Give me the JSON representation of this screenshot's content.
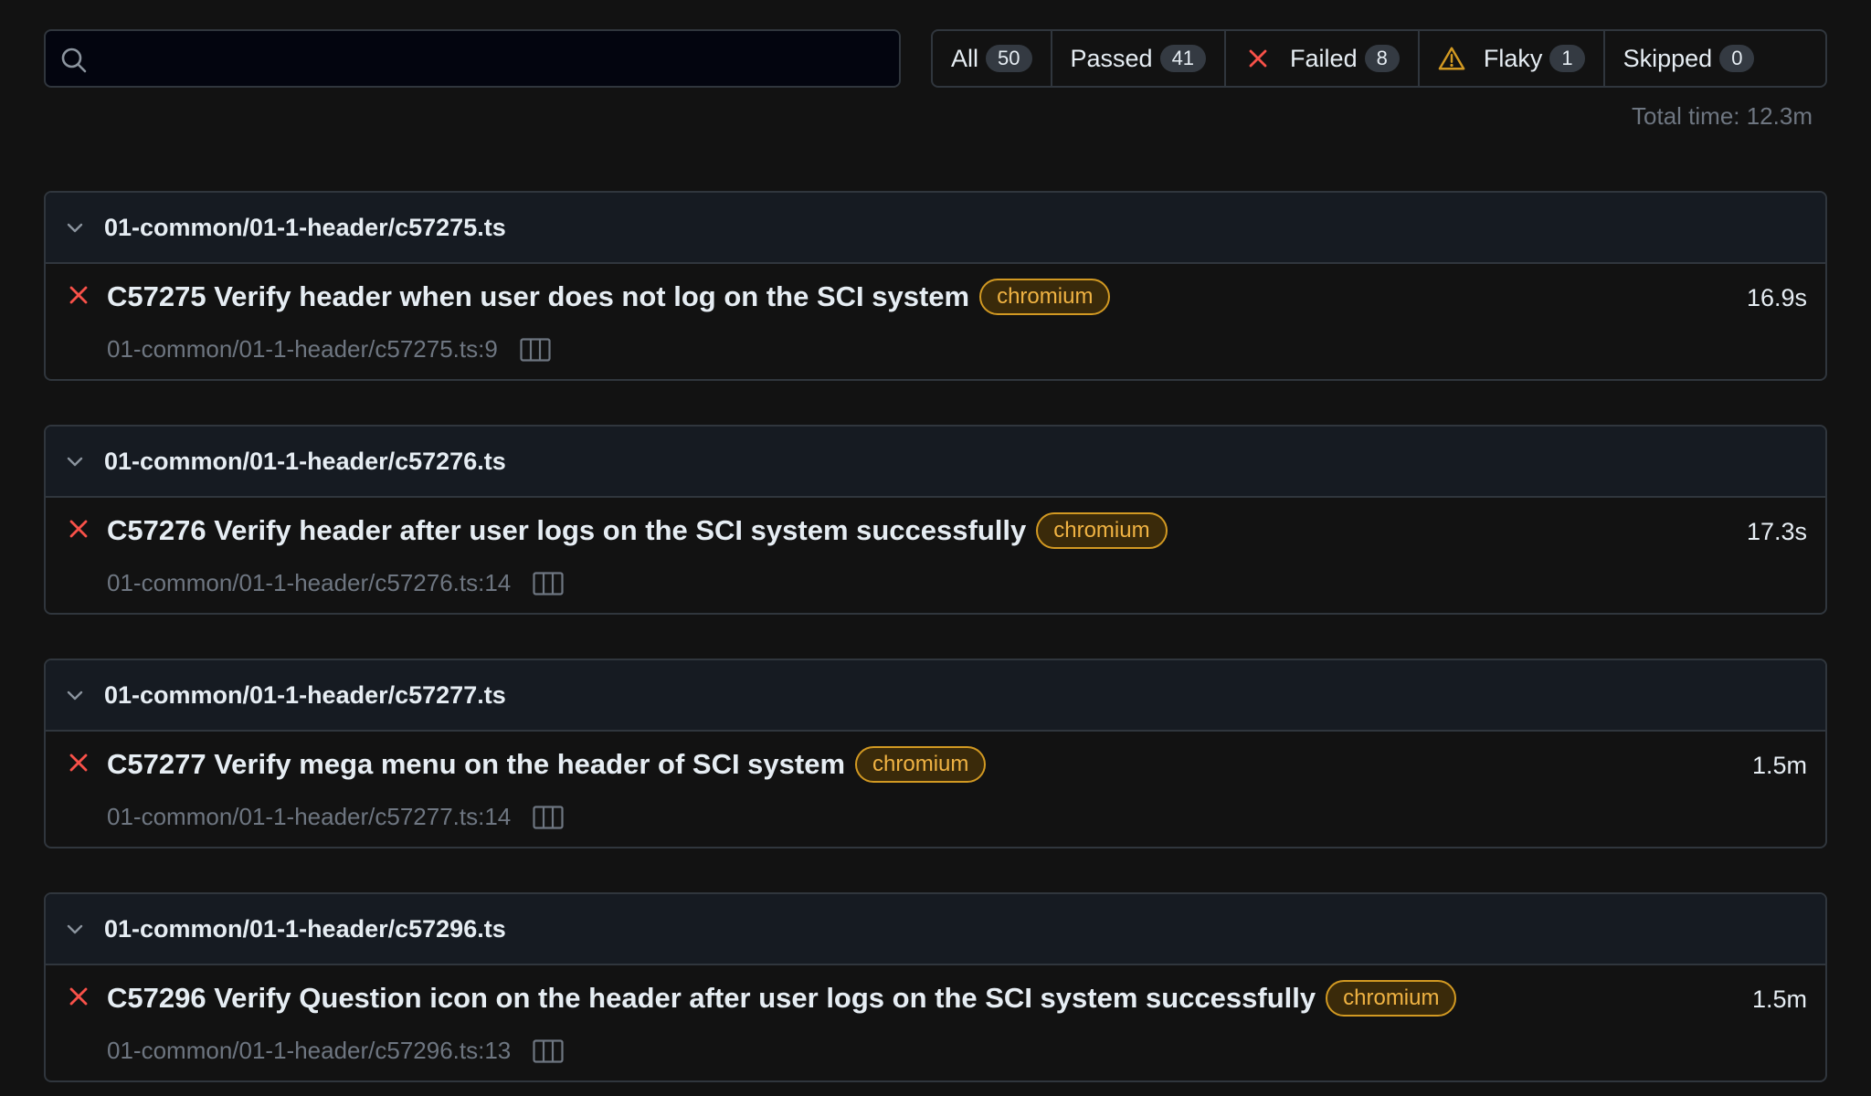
{
  "search": {
    "value": "",
    "placeholder": ""
  },
  "filters": [
    {
      "label": "All",
      "count": "50",
      "icon": ""
    },
    {
      "label": "Passed",
      "count": "41",
      "icon": ""
    },
    {
      "label": "Failed",
      "count": "8",
      "icon": "cross-icon"
    },
    {
      "label": "Flaky",
      "count": "1",
      "icon": "warning-icon"
    },
    {
      "label": "Skipped",
      "count": "0",
      "icon": ""
    }
  ],
  "total_time": "Total time: 12.3m",
  "groups": [
    {
      "file": "01-common/01-1-header/c57275.ts",
      "test": {
        "status": "failed",
        "title": "C57275 Verify header when user does not log on the SCI system",
        "tag": "chromium",
        "duration": "16.9s",
        "location": "01-common/01-1-header/c57275.ts:9"
      }
    },
    {
      "file": "01-common/01-1-header/c57276.ts",
      "test": {
        "status": "failed",
        "title": "C57276 Verify header after user logs on the SCI system successfully",
        "tag": "chromium",
        "duration": "17.3s",
        "location": "01-common/01-1-header/c57276.ts:14"
      }
    },
    {
      "file": "01-common/01-1-header/c57277.ts",
      "test": {
        "status": "failed",
        "title": "C57277 Verify mega menu on the header of SCI system",
        "tag": "chromium",
        "duration": "1.5m",
        "location": "01-common/01-1-header/c57277.ts:14"
      }
    },
    {
      "file": "01-common/01-1-header/c57296.ts",
      "test": {
        "status": "failed",
        "title": "C57296 Verify Question icon on the header after user logs on the SCI system successfully",
        "tag": "chromium",
        "duration": "1.5m",
        "location": "01-common/01-1-header/c57296.ts:13"
      }
    }
  ],
  "colors": {
    "background": "#121212",
    "group_header_bg": "#161b22",
    "border": "#30363d",
    "fail": "#f85149",
    "warning": "#d29922",
    "tag_text": "#f0b343",
    "muted": "#6e7681"
  }
}
